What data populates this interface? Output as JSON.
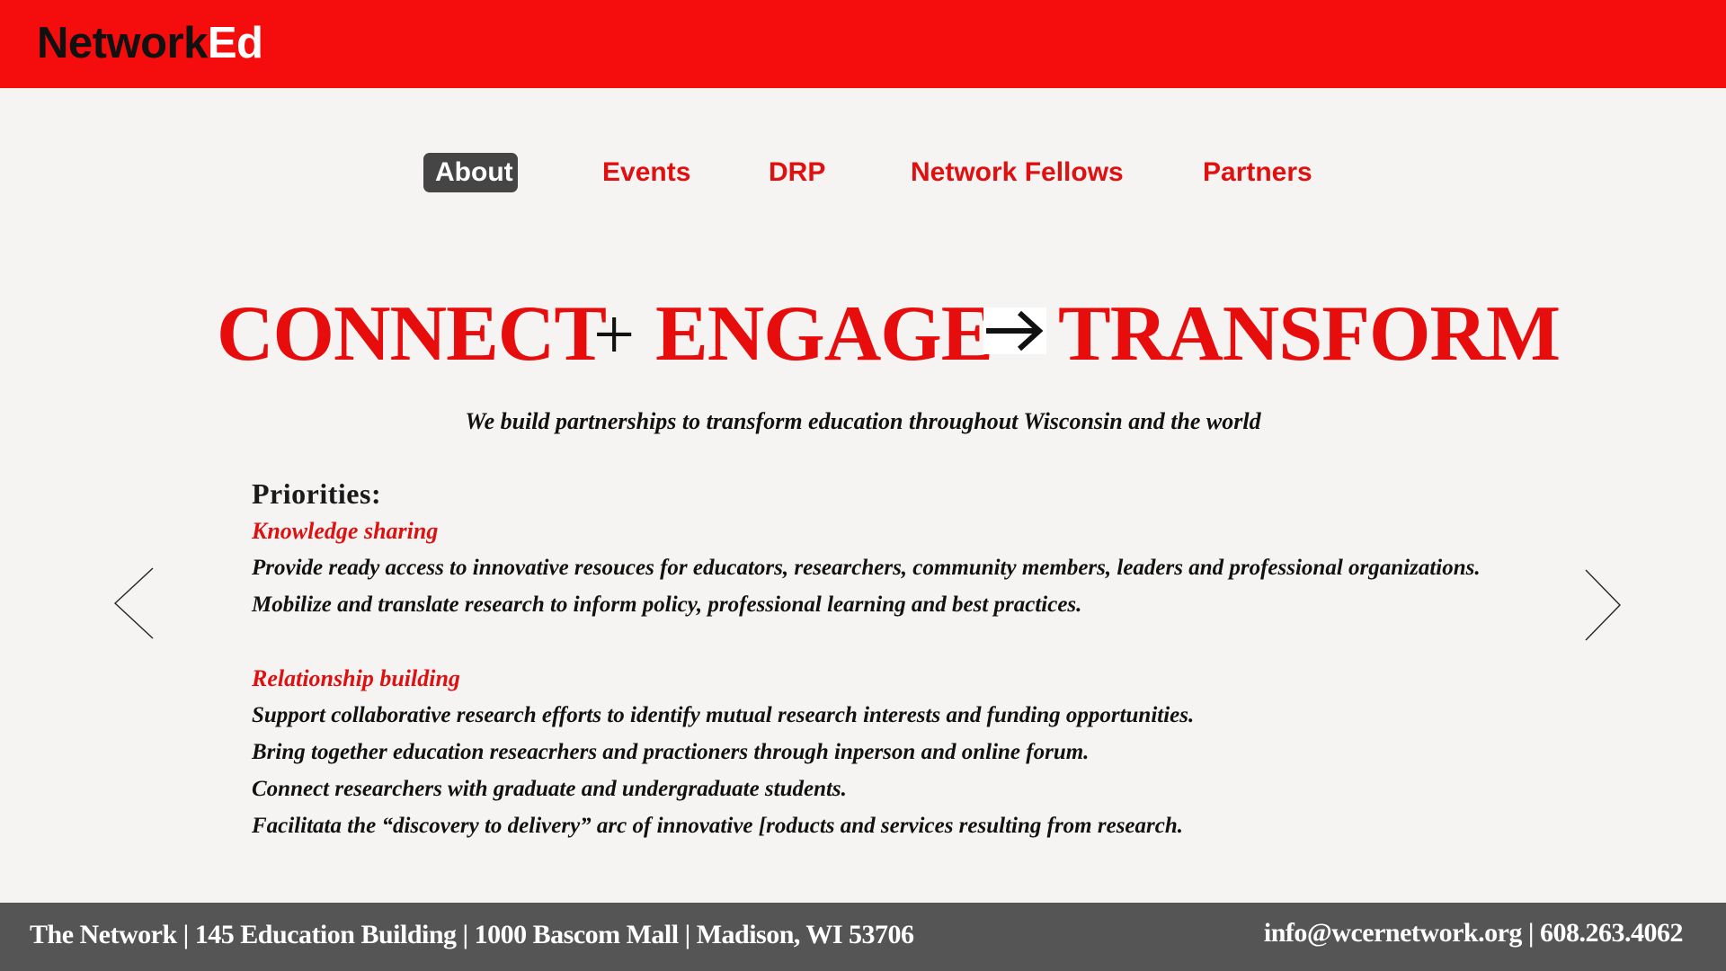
{
  "header": {
    "logo_part1": "Network",
    "logo_part2": "Ed",
    "background_color": "#f50c0c"
  },
  "nav": {
    "items": [
      {
        "label": "About",
        "active": true
      },
      {
        "label": "Events",
        "active": false
      },
      {
        "label": "DRP",
        "active": false
      },
      {
        "label": "Network Fellows",
        "active": false
      },
      {
        "label": "Partners",
        "active": false
      }
    ]
  },
  "headline": {
    "word1": "CONNECT",
    "plus": "+",
    "word2": "ENGAGE",
    "arrow_icon": "right-arrow-icon",
    "word3": "TRANSFORM",
    "accent_color": "#e80d0d"
  },
  "tagline": "We build partnerships to transform education throughout Wisconsin and the world",
  "priorities": {
    "heading": "Priorities:",
    "sections": [
      {
        "title": "Knowledge  sharing",
        "lines": [
          "Provide ready access to innovative resouces for educators, researchers, community members, leaders and professional organizations.",
          "Mobilize and translate research to inform policy, professional learning and best practices."
        ]
      },
      {
        "title": "Relationship building",
        "lines": [
          "Support collaborative research efforts to identify mutual research interests and funding opportunities.",
          "Bring together education reseacrhers and practioners through inperson and online forum.",
          "Connect researchers with graduate and undergraduate students.",
          "Facilitata the “discovery to delivery” arc of innovative [roducts and services resulting from research."
        ]
      }
    ]
  },
  "carousel": {
    "prev_icon": "chevron-left-icon",
    "next_icon": "chevron-right-icon"
  },
  "footer": {
    "address": "The Network | 145 Education Building | 1000 Bascom Mall | Madison, WI 53706",
    "contact": "info@wcernetwork.org  |  608.263.4062",
    "background_color": "#555555"
  }
}
